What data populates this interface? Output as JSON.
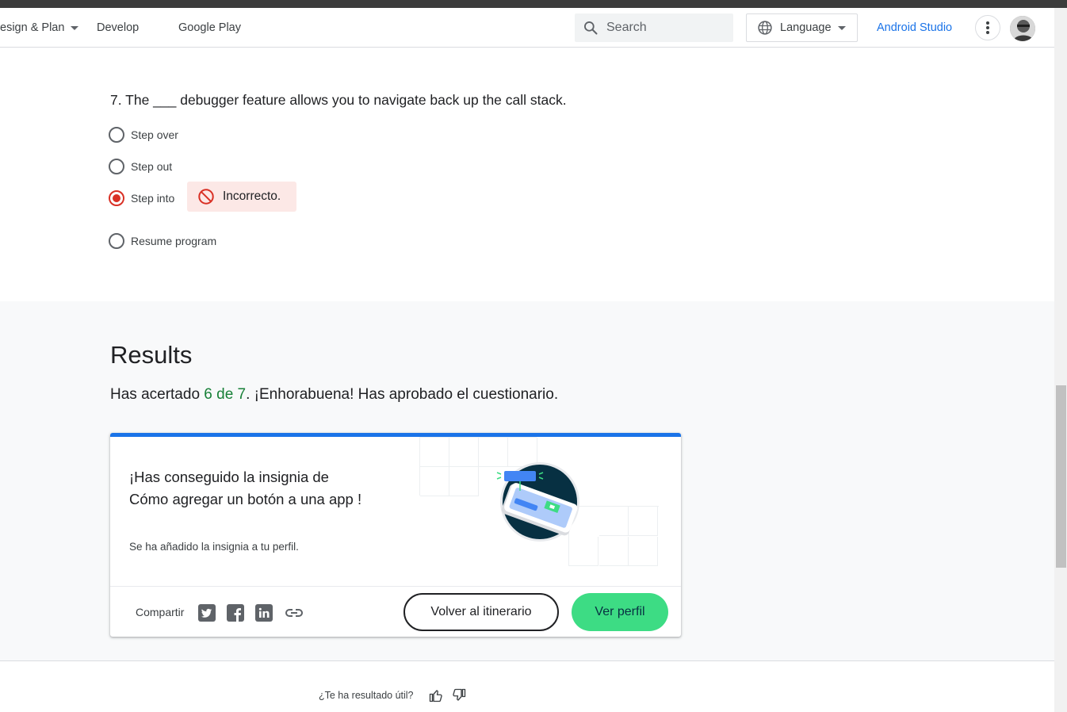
{
  "header": {
    "nav": [
      "esign & Plan",
      "Develop",
      "Google Play"
    ],
    "search_placeholder": "Search",
    "language_label": "Language",
    "studio_link": "Android Studio"
  },
  "quiz": {
    "question": "7. The ___ debugger feature allows you to navigate back up the call stack.",
    "options": [
      "Step over",
      "Step out",
      "Step into",
      "Resume program"
    ],
    "selected_index": 2,
    "feedback": "Incorrecto."
  },
  "results": {
    "title": "Results",
    "text_before": "Has acertado ",
    "score": "6 de 7",
    "text_after": ". ¡Enhorabuena! Has aprobado el cuestionario."
  },
  "badge_card": {
    "line1": "¡Has conseguido la insignia de",
    "badge_name": "Cómo agregar un botón a una app !",
    "subtitle": "Se ha añadido la insignia a tu perfil.",
    "share_label": "Compartir",
    "share_icons": [
      "twitter-icon",
      "facebook-icon",
      "linkedin-icon",
      "link-icon"
    ],
    "back_button": "Volver al itinerario",
    "profile_button": "Ver perfil",
    "accent_color": "#1a73e8",
    "button_color": "#3ddc84"
  },
  "footer": {
    "helpful_text": "¿Te ha resultado útil?"
  }
}
